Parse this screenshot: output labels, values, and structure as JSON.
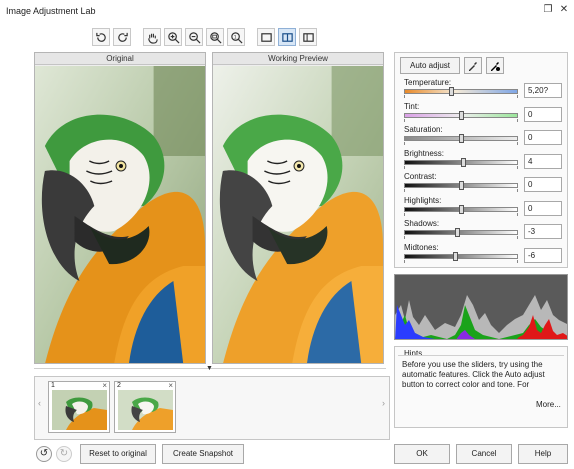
{
  "window": {
    "title": "Image Adjustment Lab",
    "restore_glyph": "❐",
    "close_glyph": "✕"
  },
  "toolbar": {
    "buttons": [
      "rotate-left-icon",
      "rotate-right-icon",
      "hand-icon",
      "zoom-in-icon",
      "zoom-out-icon",
      "zoom-fit-icon",
      "zoom-actual-icon",
      "single-view-icon",
      "split-view-icon",
      "side-by-side-icon"
    ],
    "active": "split-view-icon"
  },
  "panes": {
    "original_label": "Original",
    "preview_label": "Working Preview"
  },
  "snapshots": [
    {
      "num": "1",
      "close": "×"
    },
    {
      "num": "2",
      "close": "×"
    }
  ],
  "buttons": {
    "auto_adjust": "Auto adjust",
    "reset": "Reset to original",
    "create_snapshot": "Create Snapshot",
    "ok": "OK",
    "cancel": "Cancel",
    "help": "Help"
  },
  "sliders": [
    {
      "label": "Temperature:",
      "value": "5,20?",
      "level": 0.42
    },
    {
      "label": "Tint:",
      "value": "0",
      "level": 0.5
    },
    {
      "label": "Saturation:",
      "value": "0",
      "level": 0.5
    },
    {
      "label": "Brightness:",
      "value": "4",
      "level": 0.52
    },
    {
      "label": "Contrast:",
      "value": "0",
      "level": 0.5
    },
    {
      "label": "Highlights:",
      "value": "0",
      "level": 0.5
    },
    {
      "label": "Shadows:",
      "value": "-3",
      "level": 0.47
    },
    {
      "label": "Midtones:",
      "value": "-6",
      "level": 0.45
    }
  ],
  "hints": {
    "title": "Hints",
    "text": "Before you use the sliders, try using the automatic features. Click the Auto adjust button to correct color and tone. For",
    "more": "More..."
  },
  "colors": {
    "accent": "#d7e6f6",
    "temperature_left": "#e88a2a",
    "temperature_right": "#7fa6e6",
    "tint_left": "#d9a0e6",
    "tint_right": "#9be69b"
  }
}
